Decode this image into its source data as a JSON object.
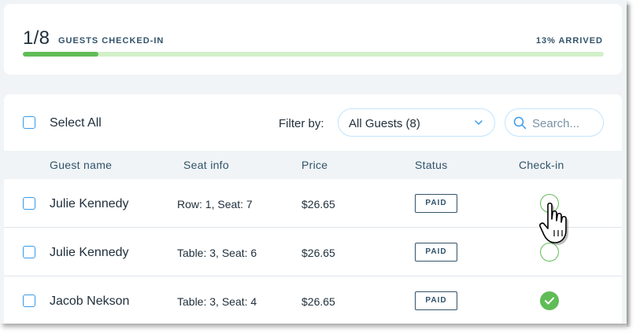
{
  "summary": {
    "count": "1/8",
    "label": "GUESTS CHECKED-IN",
    "arrived": "13% ARRIVED",
    "progress_fraction": 0.13,
    "colors": {
      "fill": "#60bc57",
      "track": "#d2f0c9"
    }
  },
  "toolbar": {
    "select_all": "Select All",
    "filter_label": "Filter by:",
    "filter_value": "All Guests (8)",
    "search_placeholder": "Search..."
  },
  "table": {
    "headers": [
      "Guest name",
      "Seat info",
      "Price",
      "Status",
      "Check-in"
    ],
    "rows": [
      {
        "name": "Julie Kennedy",
        "seat": "Row: 1, Seat: 7",
        "price": "$26.65",
        "status": "PAID",
        "checked_in": false
      },
      {
        "name": "Julie Kennedy",
        "seat": "Table: 3, Seat: 6",
        "price": "$26.65",
        "status": "PAID",
        "checked_in": false
      },
      {
        "name": "Jacob Nekson",
        "seat": "Table: 3, Seat: 4",
        "price": "$26.65",
        "status": "PAID",
        "checked_in": true
      }
    ]
  },
  "icons": {
    "dropdown": "chevron-down-icon",
    "search": "search-icon",
    "checked": "checkmark-icon",
    "cursor": "hand-pointer-cursor"
  },
  "accent_color": "#3899ec"
}
